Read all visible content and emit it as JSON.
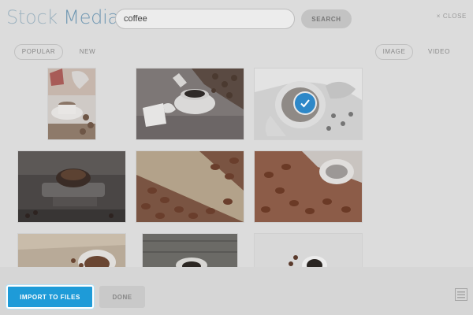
{
  "header": {
    "logo_part1": "Stock",
    "logo_part2": "Media",
    "search_value": "coffee",
    "search_button": "SEARCH",
    "close_label": "× CLOSE"
  },
  "filters": {
    "sort_popular": "POPULAR",
    "sort_new": "NEW",
    "type_image": "IMAGE",
    "type_video": "VIDEO"
  },
  "grid": {
    "selected_index": 2,
    "icons": [
      "checkmark-icon"
    ]
  },
  "footer": {
    "import_label": "IMPORT TO FILES",
    "done_label": "DONE",
    "icons": [
      "list-icon"
    ]
  },
  "colors": {
    "accent": "#1e9bd8",
    "check_badge": "#2e88c8",
    "logo_light": "#9eb3c0",
    "logo_dark": "#6f97b2"
  }
}
